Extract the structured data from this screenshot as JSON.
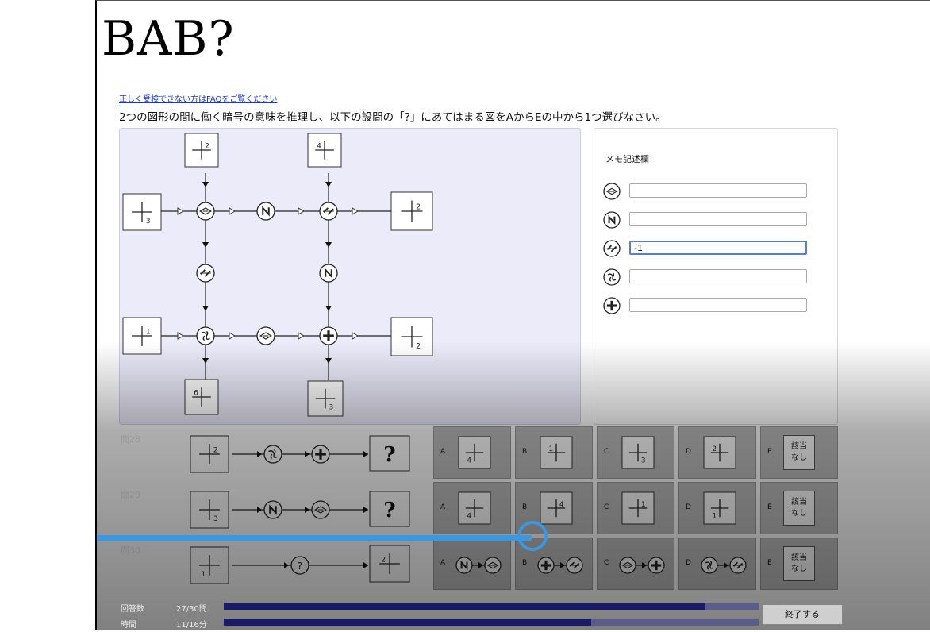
{
  "title": "BAB?",
  "faq_link": "正しく受検できない方はFAQをご覧ください",
  "instruction": "2つの図形の間に働く暗号の意味を推理し、以下の設問の「?」にあてはまる図をAからEの中から1つ選びなさい。",
  "memo": {
    "title": "メモ記述欄",
    "rows": [
      {
        "symbol": "diamond-symbol",
        "value": ""
      },
      {
        "symbol": "zigzag-n-symbol",
        "value": ""
      },
      {
        "symbol": "double-slash-symbol",
        "value": "-1"
      },
      {
        "symbol": "swirl-symbol",
        "value": ""
      },
      {
        "symbol": "bold-cross-symbol",
        "value": ""
      }
    ]
  },
  "diagram": {
    "top_left_box": {
      "sup": "2",
      "pos": "upper-right"
    },
    "top_right_box": {
      "sup": "4",
      "pos": "upper-left"
    },
    "left_upper_box": {
      "sub": "3",
      "pos": "lower-right"
    },
    "right_upper_box": {
      "sup": "2",
      "pos": "upper-right"
    },
    "left_lower_box": {
      "sup": "1",
      "pos": "upper-right"
    },
    "right_lower_box": {
      "sub": "2",
      "pos": "lower-right"
    },
    "bottom_left_box": {
      "sup": "6",
      "pos": "upper-left"
    },
    "bottom_right_box": {
      "sub": "3",
      "pos": "lower-right"
    }
  },
  "questions": [
    {
      "label": "問28",
      "start": {
        "num": "2",
        "pos": "upper-right"
      },
      "symbols": [
        "swirl-symbol",
        "bold-cross-symbol"
      ],
      "end": "?",
      "choices": [
        {
          "letter": "A",
          "num": "4",
          "pos": "lower-left"
        },
        {
          "letter": "B",
          "num": "1",
          "pos": "upper-left"
        },
        {
          "letter": "C",
          "num": "3",
          "pos": "lower-right"
        },
        {
          "letter": "D",
          "num": "2",
          "pos": "upper-left"
        },
        {
          "letter": "E",
          "text": [
            "該当",
            "なし"
          ]
        }
      ]
    },
    {
      "label": "問29",
      "start": {
        "num": "3",
        "pos": "lower-right"
      },
      "symbols": [
        "zigzag-n-symbol",
        "diamond-symbol"
      ],
      "end": "?",
      "choices": [
        {
          "letter": "A",
          "num": "4",
          "pos": "lower-left"
        },
        {
          "letter": "B",
          "num": "4",
          "pos": "upper-right"
        },
        {
          "letter": "C",
          "num": "1",
          "pos": "upper-right"
        },
        {
          "letter": "D",
          "num": "1",
          "pos": "lower-left"
        },
        {
          "letter": "E",
          "text": [
            "該当",
            "なし"
          ]
        }
      ]
    },
    {
      "label": "問30",
      "start": {
        "num": "1",
        "pos": "lower-left"
      },
      "symbols": [
        "?"
      ],
      "end": {
        "num": "2",
        "pos": "upper-left"
      },
      "choices": [
        {
          "letter": "A",
          "symbols": [
            "zigzag-n-symbol",
            "diamond-symbol"
          ]
        },
        {
          "letter": "B",
          "symbols": [
            "bold-cross-symbol",
            "double-slash-symbol"
          ]
        },
        {
          "letter": "C",
          "symbols": [
            "diamond-symbol",
            "bold-cross-symbol"
          ]
        },
        {
          "letter": "D",
          "symbols": [
            "swirl-symbol",
            "double-slash-symbol"
          ]
        },
        {
          "letter": "E",
          "text": [
            "該当",
            "なし"
          ]
        }
      ]
    }
  ],
  "status": {
    "answers_label": "回答数",
    "answers_value": "27/30問",
    "answers_fraction": 0.9,
    "time_label": "時間",
    "time_value": "11/16分",
    "time_fraction": 0.6875,
    "end_button": "終了する"
  },
  "video_progress": 0.57
}
